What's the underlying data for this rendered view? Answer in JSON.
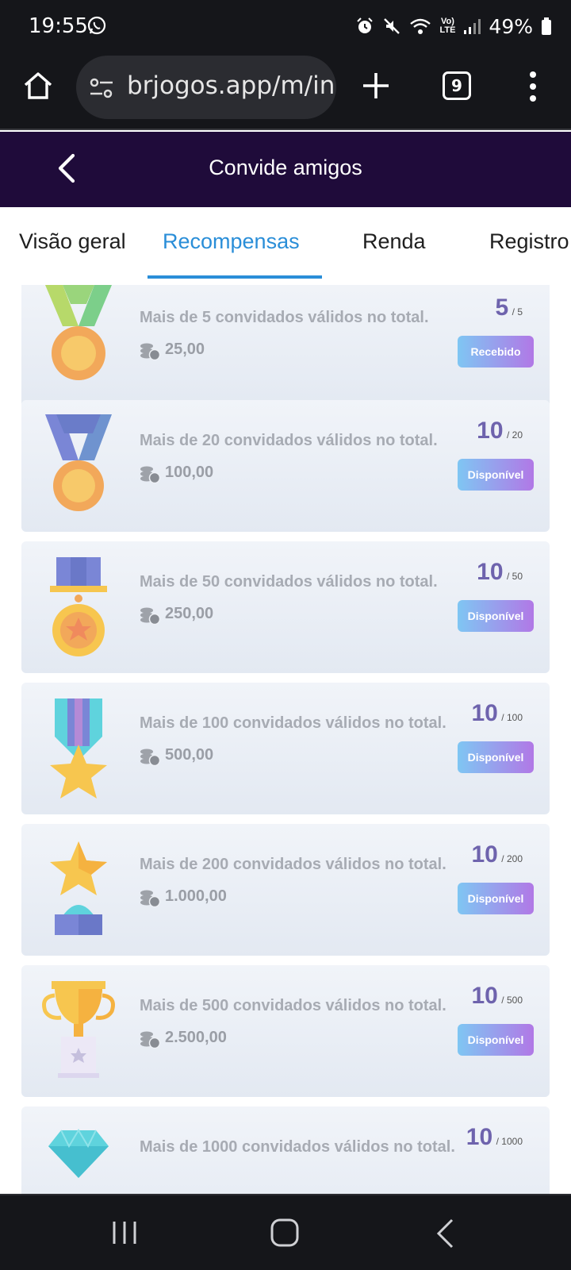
{
  "status_bar": {
    "time": "19:55",
    "battery": "49%",
    "lte_label": "LTE"
  },
  "browser": {
    "url": "brjogos.app/m/inv",
    "tab_count": "9"
  },
  "header": {
    "title": "Convide amigos"
  },
  "tabs": [
    {
      "label": "Visão geral"
    },
    {
      "label": "Recompensas"
    },
    {
      "label": "Renda"
    },
    {
      "label": "Registro"
    }
  ],
  "rewards": [
    {
      "description": "Mais de 5 convidados válidos no total.",
      "amount": "25,00",
      "current": "5",
      "target": "5",
      "status": "Recebido",
      "icon": "green-ribbon-medal-icon"
    },
    {
      "description": "Mais de 20 convidados válidos no total.",
      "amount": "100,00",
      "current": "10",
      "target": "20",
      "status": "Disponível",
      "icon": "blue-ribbon-medal-icon"
    },
    {
      "description": "Mais de 50 convidados válidos no total.",
      "amount": "250,00",
      "current": "10",
      "target": "50",
      "status": "Disponível",
      "icon": "star-medal-icon"
    },
    {
      "description": "Mais de 100 convidados válidos no total.",
      "amount": "500,00",
      "current": "10",
      "target": "100",
      "status": "Disponível",
      "icon": "star-ribbon-icon"
    },
    {
      "description": "Mais de 200 convidados válidos no total.",
      "amount": "1.000,00",
      "current": "10",
      "target": "200",
      "status": "Disponível",
      "icon": "star-trophy-icon"
    },
    {
      "description": "Mais de 500 convidados válidos no total.",
      "amount": "2.500,00",
      "current": "10",
      "target": "500",
      "status": "Disponível",
      "icon": "gold-cup-icon"
    },
    {
      "description": "Mais de 1000 convidados válidos no total.",
      "amount": "",
      "current": "10",
      "target": "1000",
      "status": "",
      "icon": "diamond-icon"
    }
  ],
  "colors": {
    "header_bg": "#1f0b3a",
    "tab_active": "#2a8ed8",
    "progress": "#6e63ad",
    "button_start": "#7fc6f3",
    "button_end": "#b178e6"
  }
}
